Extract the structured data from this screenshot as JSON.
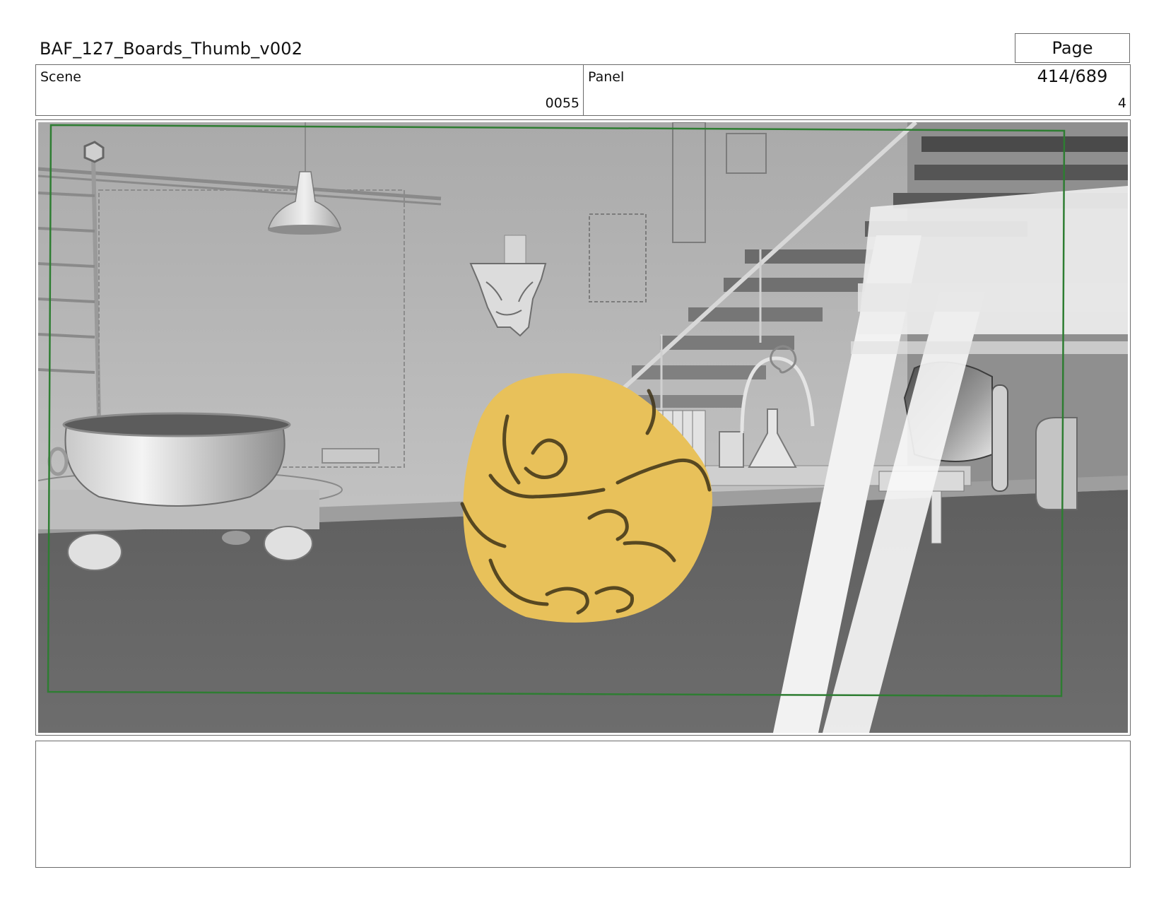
{
  "header": {
    "title": "BAF_127_Boards_Thumb_v002",
    "page": "Page 414/689"
  },
  "scene": {
    "label": "Scene",
    "value": "0055"
  },
  "panel": {
    "label": "Panel",
    "value": "4"
  },
  "notes": {
    "text": ""
  },
  "colors": {
    "safe_frame": "#2e7d32",
    "character_fill": "#e8c15a",
    "floor": "#6b6b6b",
    "wall": "#b7b7b7"
  }
}
